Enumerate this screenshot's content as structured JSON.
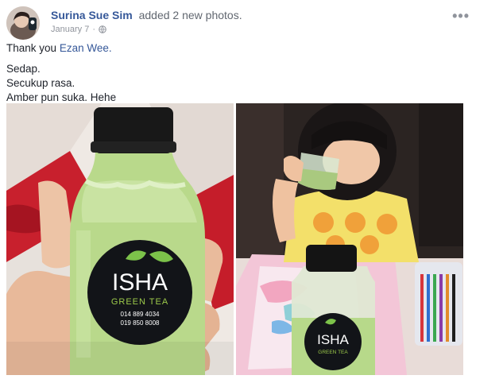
{
  "post": {
    "author": "Surina Sue Sim",
    "action": "added 2 new photos.",
    "date": "January 7",
    "date_separator": "·",
    "more_icon": "ellipsis-icon",
    "privacy_icon": "globe-icon"
  },
  "message": {
    "thanks_prefix": "Thank you",
    "mention": "Ezan Wee.",
    "lines": [
      "Sedap.",
      "Secukup rasa.",
      "Amber pun suka. Hehe"
    ]
  },
  "photos": [
    {
      "brand": "ISHA",
      "tagline": "GREEN TEA",
      "phone1": "014 889 4034",
      "phone2": "019 850 8008"
    },
    {
      "brand": "ISHA",
      "tagline": "GREEN TEA"
    }
  ],
  "colors": {
    "link": "#365899",
    "meta": "#90949c",
    "tea": "#b8d88a",
    "label_green": "#9cc94a"
  }
}
